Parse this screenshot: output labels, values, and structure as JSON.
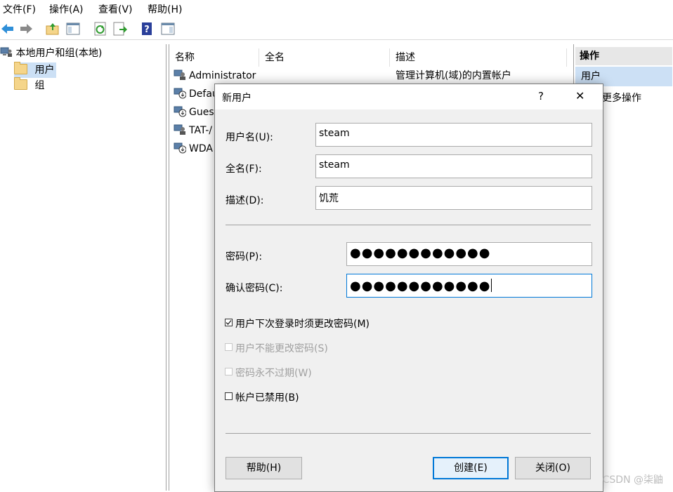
{
  "menu": [
    "文件(F)",
    "操作(A)",
    "查看(V)",
    "帮助(H)"
  ],
  "tree": {
    "root": "本地用户和组(本地)",
    "items": [
      "用户",
      "组"
    ]
  },
  "list": {
    "columns": [
      "名称",
      "全名",
      "描述"
    ],
    "rows": [
      {
        "name": "Administrator",
        "fullname": "",
        "desc": "管理计算机(域)的内置帐户"
      },
      {
        "name": "Defau",
        "fullname": "",
        "desc": ""
      },
      {
        "name": "Gues",
        "fullname": "",
        "desc": ""
      },
      {
        "name": "TAT-/",
        "fullname": "",
        "desc": ""
      },
      {
        "name": "WDA",
        "fullname": "",
        "desc": ""
      }
    ]
  },
  "actions": {
    "header": "操作",
    "selected": "用户",
    "more": "更多操作"
  },
  "dialog": {
    "title": "新用户",
    "help_glyph": "?",
    "close_glyph": "✕",
    "username_label": "用户名(U):",
    "username_value": "steam",
    "fullname_label": "全名(F):",
    "fullname_value": "steam",
    "description_label": "描述(D):",
    "description_value": "饥荒",
    "password_label": "密码(P):",
    "password_value": "●●●●●●●●●●●●",
    "confirm_label": "确认密码(C):",
    "confirm_value": "●●●●●●●●●●●●",
    "checkboxes": [
      {
        "label": "用户下次登录时须更改密码(M)",
        "checked": true,
        "disabled": false
      },
      {
        "label": "用户不能更改密码(S)",
        "checked": false,
        "disabled": true
      },
      {
        "label": "密码永不过期(W)",
        "checked": false,
        "disabled": true
      },
      {
        "label": "帐户已禁用(B)",
        "checked": false,
        "disabled": false
      }
    ],
    "help_button": "帮助(H)",
    "create_button": "创建(E)",
    "close_button": "关闭(O)"
  },
  "watermark": "CSDN @柒鼬",
  "colors": {
    "selection": "#cce0f5",
    "focus_border": "#0078d7",
    "dialog_bg": "#f0f0f0"
  }
}
